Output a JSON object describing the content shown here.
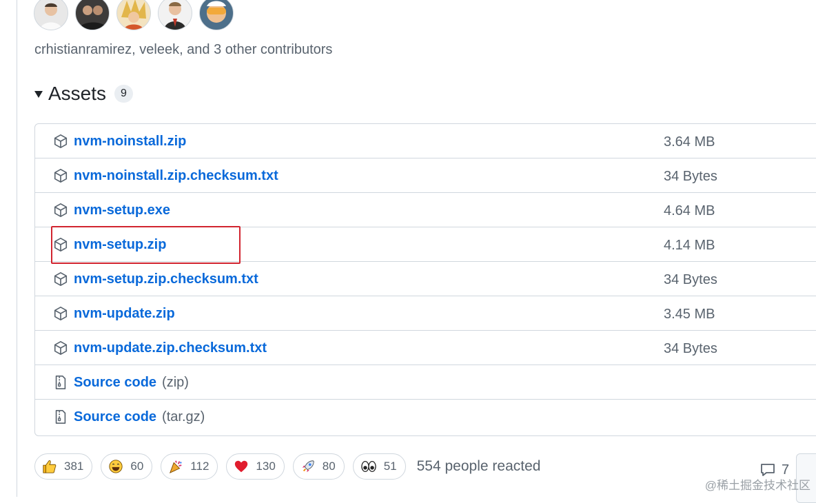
{
  "contributors": {
    "avatars": [
      "avatar-1",
      "avatar-2",
      "avatar-3",
      "avatar-4",
      "avatar-5"
    ],
    "text": "crhistianramirez, veleek, and 3 other contributors"
  },
  "assets": {
    "title": "Assets",
    "count": "9",
    "rows": [
      {
        "icon": "package-icon",
        "name": "nvm-noinstall.zip",
        "size": "3.64 MB"
      },
      {
        "icon": "package-icon",
        "name": "nvm-noinstall.zip.checksum.txt",
        "size": "34 Bytes"
      },
      {
        "icon": "package-icon",
        "name": "nvm-setup.exe",
        "size": "4.64 MB"
      },
      {
        "icon": "package-icon",
        "name": "nvm-setup.zip",
        "size": "4.14 MB"
      },
      {
        "icon": "package-icon",
        "name": "nvm-setup.zip.checksum.txt",
        "size": "34 Bytes"
      },
      {
        "icon": "package-icon",
        "name": "nvm-update.zip",
        "size": "3.45 MB"
      },
      {
        "icon": "package-icon",
        "name": "nvm-update.zip.checksum.txt",
        "size": "34 Bytes"
      },
      {
        "icon": "file-zip-icon",
        "name": "Source code",
        "ext": "(zip)"
      },
      {
        "icon": "file-zip-icon",
        "name": "Source code",
        "ext": "(tar.gz)"
      }
    ]
  },
  "highlight_color": "#d1242f",
  "link_color": "#0969da",
  "reactions": {
    "items": [
      {
        "icon": "thumbs-up-icon",
        "count": "381"
      },
      {
        "icon": "laugh-icon",
        "count": "60"
      },
      {
        "icon": "hooray-icon",
        "count": "112"
      },
      {
        "icon": "heart-icon",
        "count": "130"
      },
      {
        "icon": "rocket-icon",
        "count": "80"
      },
      {
        "icon": "eyes-icon",
        "count": "51"
      }
    ],
    "summary": "554 people reacted"
  },
  "comments": {
    "icon": "comment-icon",
    "count": "7"
  },
  "watermark": "@稀土掘金技术社区"
}
